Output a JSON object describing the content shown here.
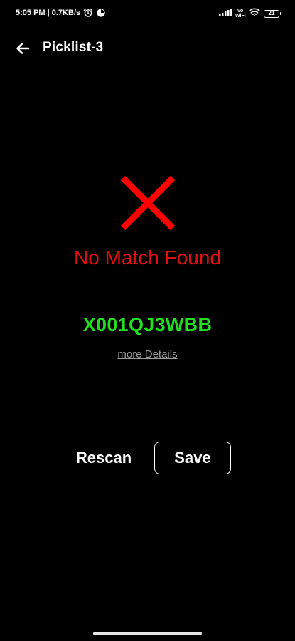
{
  "status_bar": {
    "time_speed": "5:05 PM | 0.7KB/s",
    "volte_line1": "Vo",
    "volte_line2": "WiFi",
    "battery_level": "21",
    "icons": [
      "alarm-icon",
      "app-notification-icon",
      "signal-icon",
      "volte-icon",
      "wifi-icon",
      "battery-icon"
    ]
  },
  "header": {
    "back_icon": "arrow-left-icon",
    "title": "Picklist-3"
  },
  "result": {
    "icon": "cross-icon",
    "icon_color": "#ff0000",
    "message": "No Match Found",
    "message_color": "#e01010",
    "code": "X001QJ3WBB",
    "code_color": "#22dd22",
    "details_link": "more Details"
  },
  "actions": {
    "rescan_label": "Rescan",
    "save_label": "Save"
  }
}
